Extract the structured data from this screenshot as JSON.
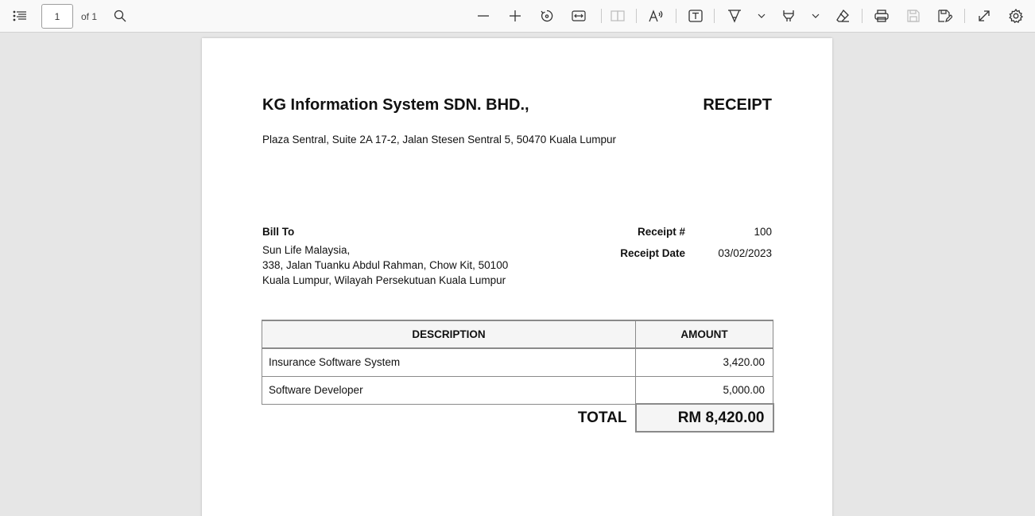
{
  "toolbar": {
    "page_current": "1",
    "page_of": "of 1",
    "icons": [
      "contents-icon",
      "search-icon",
      "zoom-out-icon",
      "zoom-in-icon",
      "rotate-icon",
      "fit-width-icon",
      "two-page-icon",
      "read-aloud-icon",
      "text-box-icon",
      "draw-icon",
      "highlight-icon",
      "eraser-icon",
      "print-icon",
      "save-icon",
      "save-as-icon",
      "fullscreen-icon",
      "settings-icon"
    ]
  },
  "receipt": {
    "company": "KG Information System SDN. BHD.,",
    "title": "RECEIPT",
    "address": "Plaza Sentral, Suite 2A 17-2, Jalan Stesen Sentral 5, 50470 Kuala Lumpur",
    "bill_to_label": "Bill To",
    "bill_to_lines": [
      "Sun Life Malaysia,",
      "338, Jalan Tuanku Abdul Rahman, Chow Kit, 50100",
      "Kuala Lumpur, Wilayah Persekutuan Kuala Lumpur"
    ],
    "receipt_no_label": "Receipt #",
    "receipt_no": "100",
    "receipt_date_label": "Receipt Date",
    "receipt_date": "03/02/2023",
    "table": {
      "headers": [
        "DESCRIPTION",
        "AMOUNT"
      ],
      "rows": [
        {
          "description": "Insurance Software System",
          "amount": "3,420.00"
        },
        {
          "description": "Software Developer",
          "amount": "5,000.00"
        }
      ],
      "total_label": "TOTAL",
      "total_value": "RM 8,420.00"
    }
  },
  "colors": {
    "toolbar_bg": "#f9f9f9",
    "viewer_bg": "#e6e6e6",
    "table_header_bg": "#f5f5f5",
    "border": "#8a8a8a"
  }
}
